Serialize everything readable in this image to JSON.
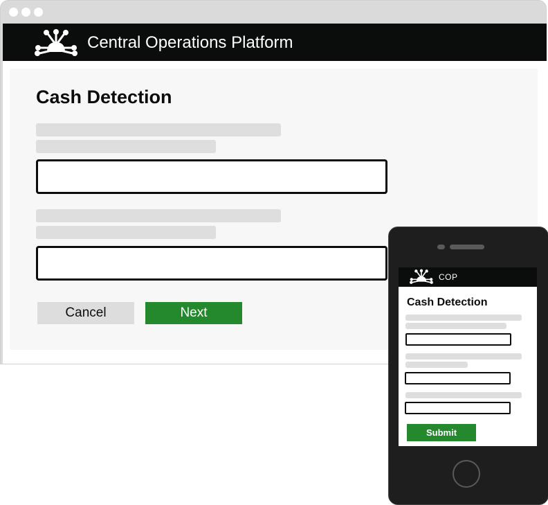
{
  "desktop": {
    "header": {
      "title": "Central Operations Platform",
      "logo": "network-hub-icon"
    },
    "page_title": "Cash Detection",
    "buttons": {
      "cancel_label": "Cancel",
      "next_label": "Next"
    },
    "colors": {
      "header_bg": "#0b0c0c",
      "primary_button": "#24892d",
      "secondary_button": "#dddddd"
    }
  },
  "mobile": {
    "header": {
      "title": "COP",
      "logo": "network-hub-icon"
    },
    "page_title": "Cash Detection",
    "buttons": {
      "submit_label": "Submit"
    }
  }
}
